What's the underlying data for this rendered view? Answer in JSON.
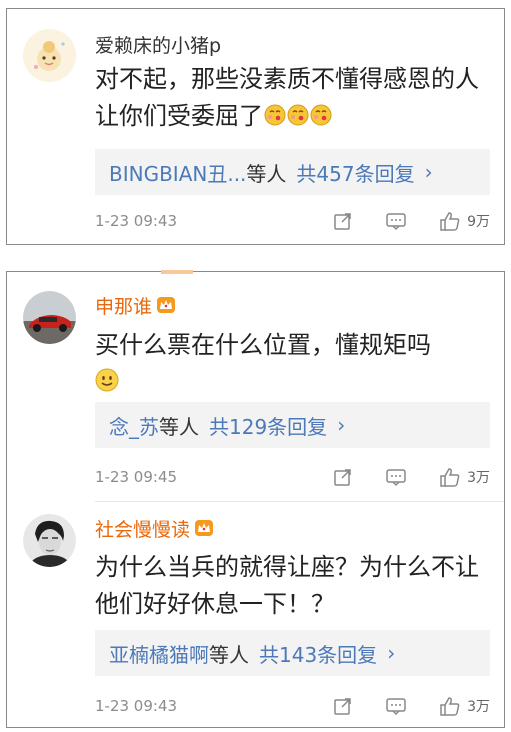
{
  "comments": [
    {
      "username": "爱赖床的小猪p",
      "text": "对不起，那些没素质不懂得感恩的人让你们受委屈了",
      "reply_users": "BINGBIAN丑...",
      "reply_etc": "等人",
      "reply_count": "共457条回复",
      "time": "1-23 09:43",
      "likes": "9万",
      "emoji_icon": "kiss-emoji-icon"
    },
    {
      "username": "申那谁",
      "text": "买什么票在什么位置，懂规矩吗",
      "reply_users": "念_苏",
      "reply_etc": "等人",
      "reply_count": "共129条回复",
      "time": "1-23 09:45",
      "likes": "3万",
      "emoji_icon": "smile-emoji-icon"
    },
    {
      "username": "社会慢慢读",
      "text": "为什么当兵的就得让座？为什么不让他们好好休息一下！？",
      "reply_users": "亚楠橘猫啊",
      "reply_etc": "等人",
      "reply_count": "共143条回复",
      "time": "1-23 09:43",
      "likes": "3万"
    }
  ],
  "colors": {
    "vip_name": "#e8690d",
    "link_blue": "#4c79b8",
    "reply_bg": "#f3f3f3",
    "meta_gray": "#8c8c8c"
  },
  "reply_arrow": "›"
}
